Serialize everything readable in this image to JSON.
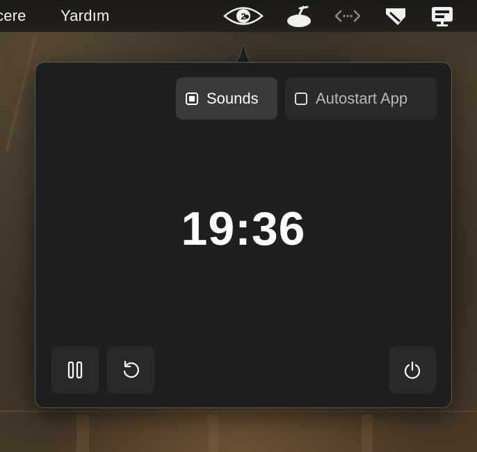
{
  "menubar": {
    "items": [
      "cere",
      "Yardım"
    ],
    "tray_icons": [
      "eye-badge-icon",
      "broom-icon",
      "code-arrows-icon",
      "tag-icon",
      "display-status-icon"
    ],
    "eye_badge_count": "2"
  },
  "popover": {
    "toggles": {
      "sounds": {
        "label": "Sounds",
        "checked": true
      },
      "autostart": {
        "label": "Autostart App",
        "checked": false
      }
    },
    "timer": "19:36",
    "controls": [
      "pause-icon",
      "restart-icon",
      "power-icon"
    ]
  },
  "colors": {
    "popover_bg": "#1f1f1f",
    "active_toggle_bg": "#3a3a3a",
    "inactive_toggle_bg": "#2a2a2a",
    "text": "#ffffff"
  }
}
